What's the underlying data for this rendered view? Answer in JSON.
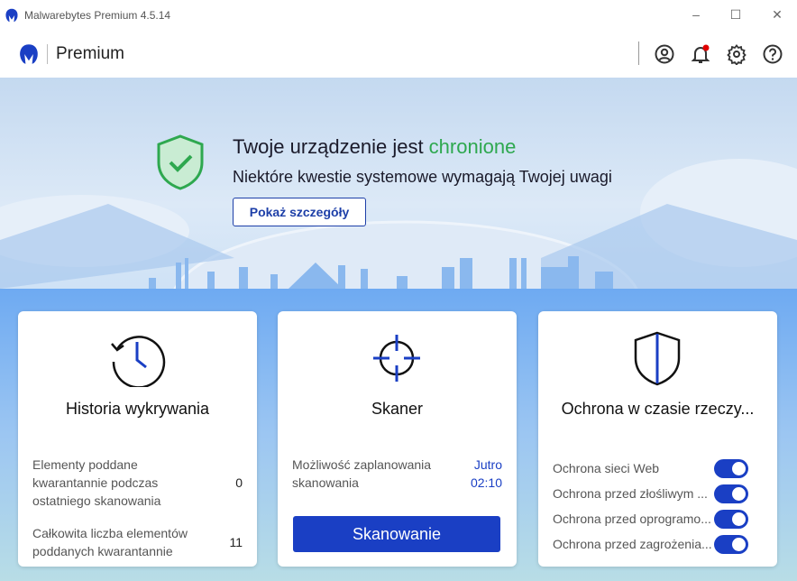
{
  "window": {
    "title": "Malwarebytes Premium  4.5.14"
  },
  "header": {
    "product": "Premium"
  },
  "banner": {
    "title_prefix": "Twoje urządzenie jest ",
    "title_status": "chronione",
    "subtitle": "Niektóre kwestie systemowe wymagają Twojej uwagi",
    "details_button": "Pokaż szczegóły"
  },
  "cards": {
    "history": {
      "title": "Historia wykrywania",
      "rows": [
        {
          "label": "Elementy poddane kwarantannie podczas ostatniego skanowania",
          "value": "0"
        },
        {
          "label": "Całkowita liczba elementów poddanych kwarantannie",
          "value": "11"
        }
      ]
    },
    "scanner": {
      "title": "Skaner",
      "label": "Możliwość zaplanowania skanowania",
      "day": "Jutro",
      "time": "02:10",
      "button": "Skanowanie"
    },
    "realtime": {
      "title": "Ochrona w czasie rzeczy...",
      "toggles": [
        {
          "label": "Ochrona sieci Web",
          "on": true
        },
        {
          "label": "Ochrona przed złośliwym ...",
          "on": true
        },
        {
          "label": "Ochrona przed oprogramo...",
          "on": true
        },
        {
          "label": "Ochrona przed zagrożenia...",
          "on": true
        }
      ]
    }
  },
  "colors": {
    "accent": "#1a3fc4",
    "green": "#2ea84f",
    "notify": "#e00000"
  }
}
